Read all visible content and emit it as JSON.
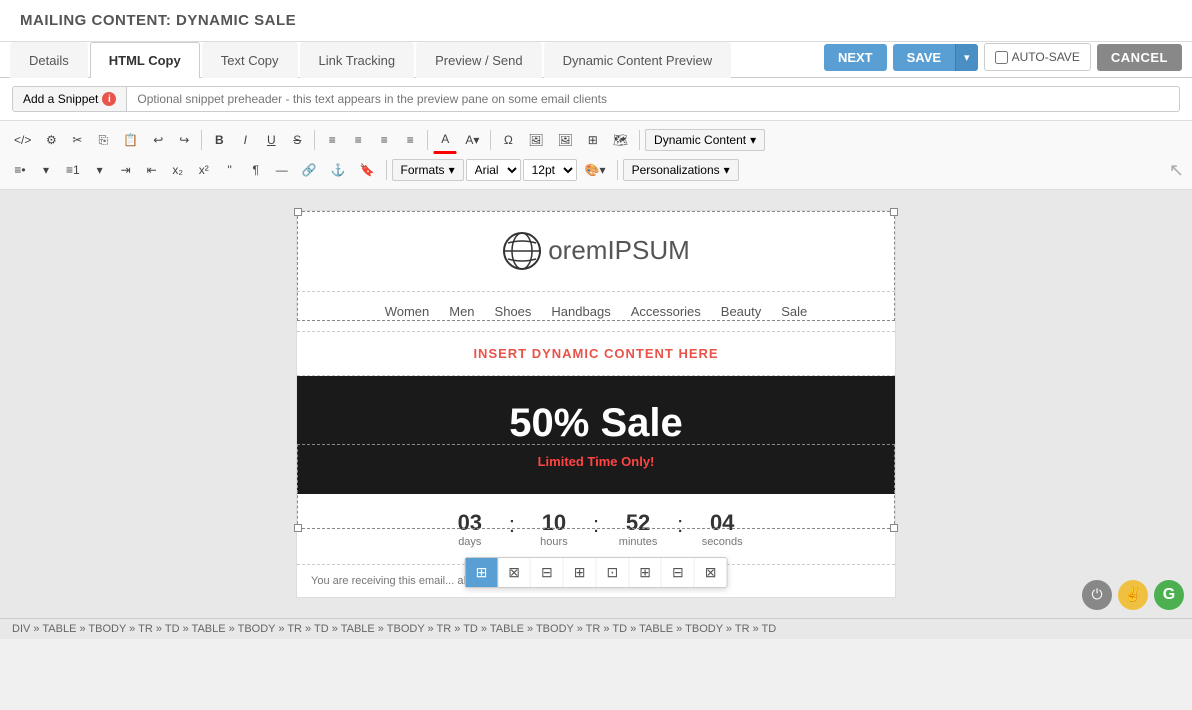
{
  "page": {
    "title": "MAILING CONTENT: DYNAMIC SALE"
  },
  "tabs": [
    {
      "id": "details",
      "label": "Details",
      "active": false
    },
    {
      "id": "html-copy",
      "label": "HTML Copy",
      "active": true
    },
    {
      "id": "text-copy",
      "label": "Text Copy",
      "active": false
    },
    {
      "id": "link-tracking",
      "label": "Link Tracking",
      "active": false
    },
    {
      "id": "preview-send",
      "label": "Preview / Send",
      "active": false
    },
    {
      "id": "dynamic-content-preview",
      "label": "Dynamic Content Preview",
      "active": false
    }
  ],
  "buttons": {
    "next": "NEXT",
    "save": "SAVE",
    "autosave": "AUTO-SAVE",
    "cancel": "CANCEL"
  },
  "snippet": {
    "btn_label": "Add a Snippet",
    "placeholder": "Optional snippet preheader - this text appears in the preview pane on some email clients"
  },
  "toolbar": {
    "row1": {
      "dynamic_content": "Dynamic Content"
    },
    "row2": {
      "formats": "Formats",
      "font": "Arial",
      "size": "12pt",
      "personalizations": "Personalizations"
    }
  },
  "email": {
    "logo_text_regular": "orem",
    "logo_text_bold": "IPSUM",
    "nav_items": [
      "Women",
      "Men",
      "Shoes",
      "Handbags",
      "Accessories",
      "Beauty",
      "Sale"
    ],
    "dynamic_placeholder": "INSERT DYNAMIC CONTENT HERE",
    "sale_title": "50% Sale",
    "sale_subtitle_1": "Limited Time Only",
    "countdown": {
      "days_num": "03",
      "days_label": "days",
      "hours_num": "10",
      "hours_label": "hours",
      "minutes_num": "52",
      "minutes_label": "minutes",
      "seconds_num": "04",
      "seconds_label": "seconds"
    },
    "footer_text": "You are receiving this email"
  },
  "status_bar": {
    "breadcrumb": "DIV » TABLE » TBODY » TR » TD » TABLE » TBODY » TR » TD » TABLE » TBODY » TR » TD » TABLE » TBODY » TR » TD » TABLE » TBODY » TR » TD"
  }
}
